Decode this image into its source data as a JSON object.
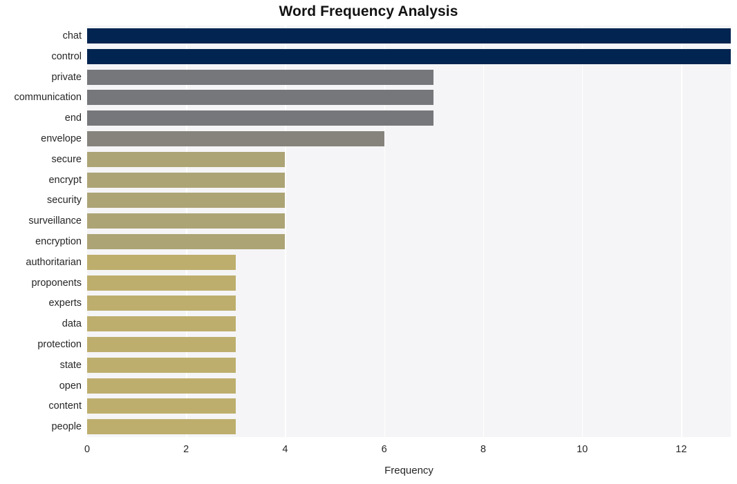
{
  "chart_data": {
    "type": "bar",
    "orientation": "horizontal",
    "title": "Word Frequency Analysis",
    "xlabel": "Frequency",
    "ylabel": "",
    "xlim": [
      0,
      13
    ],
    "ylim": null,
    "grid": "vertical-white-gridlines",
    "legend": null,
    "plot_background": "#f5f5f7",
    "figure_background": "#ffffff",
    "xticks": [
      0,
      2,
      4,
      6,
      8,
      10,
      12
    ],
    "xtick_labels": [
      "0",
      "2",
      "4",
      "6",
      "8",
      "10",
      "12"
    ],
    "categories": [
      "chat",
      "control",
      "private",
      "communication",
      "end",
      "envelope",
      "secure",
      "encrypt",
      "security",
      "surveillance",
      "encryption",
      "authoritarian",
      "proponents",
      "experts",
      "data",
      "protection",
      "state",
      "open",
      "content",
      "people"
    ],
    "values": [
      13,
      13,
      7,
      7,
      7,
      6,
      4,
      4,
      4,
      4,
      4,
      3,
      3,
      3,
      3,
      3,
      3,
      3,
      3,
      3
    ],
    "bar_colors": [
      "#022450",
      "#022450",
      "#76777a",
      "#76777a",
      "#76777a",
      "#85837c",
      "#ada476",
      "#ada476",
      "#ada476",
      "#ada476",
      "#ada476",
      "#bdae6d",
      "#bdae6d",
      "#bdae6d",
      "#bdae6d",
      "#bdae6d",
      "#bdae6d",
      "#bdae6d",
      "#bdae6d",
      "#bdae6d"
    ]
  },
  "colors": {
    "navy": "#022450",
    "gray": "#76777a",
    "warm_gray": "#85837c",
    "khaki": "#ada476",
    "gold": "#bdae6d",
    "plot_bg": "#f5f5f7",
    "gridline": "#ffffff",
    "text": "#262626",
    "title_text": "#121212"
  }
}
